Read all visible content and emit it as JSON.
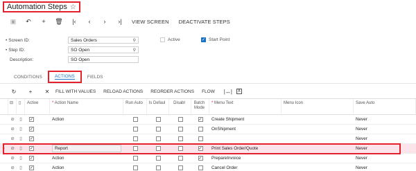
{
  "title": "Automation Steps",
  "toolbar": {
    "view_screen": "VIEW SCREEN",
    "deactivate_steps": "DEACTIVATE STEPS"
  },
  "form": {
    "screen_id_label": "Screen ID:",
    "screen_id_value": "Sales Orders",
    "step_id_label": "Step ID:",
    "step_id_value": "SO Open",
    "description_label": "Description:",
    "description_value": "SO Open",
    "active_label": "Active",
    "start_point_label": "Start Point"
  },
  "tabs": [
    "CONDITIONS",
    "ACTIONS",
    "FIELDS"
  ],
  "grid_toolbar": {
    "fill_with_values": "FILL WITH VALUES",
    "reload_actions": "RELOAD ACTIONS",
    "reorder_actions": "REORDER ACTIONS",
    "flow": "FLOW"
  },
  "columns": {
    "active": "Active",
    "action_name": "Action Name",
    "run_auto": "Run Auto",
    "is_default": "Is Defaul",
    "disable": "Disabl",
    "batch_mode": "Batch Mode",
    "menu_text": "Menu Text",
    "menu_icon": "Menu Icon",
    "save_auto": "Save Auto"
  },
  "rows": [
    {
      "action_name": "Action",
      "menu_text": "Create Shipment",
      "save_auto": "Never",
      "active": true,
      "run_auto": false,
      "is_default": false,
      "disable": false,
      "batch": true
    },
    {
      "action_name": "",
      "menu_text": "OnShipment",
      "save_auto": "Never",
      "active": true,
      "run_auto": false,
      "is_default": false,
      "disable": false,
      "batch": false
    },
    {
      "action_name": "",
      "menu_text": "",
      "save_auto": "Never",
      "active": true,
      "run_auto": false,
      "is_default": false,
      "disable": false,
      "batch": false
    },
    {
      "action_name": "Report",
      "menu_text": "Print Sales Order/Quote",
      "save_auto": "Never",
      "active": true,
      "run_auto": false,
      "is_default": false,
      "disable": false,
      "batch": true
    },
    {
      "action_name": "Action",
      "menu_text": "PrepareInvoice",
      "save_auto": "Never",
      "active": true,
      "run_auto": false,
      "is_default": false,
      "disable": false,
      "batch": true
    },
    {
      "action_name": "Action",
      "menu_text": "Cancel Order",
      "save_auto": "Never",
      "active": true,
      "run_auto": false,
      "is_default": false,
      "disable": false,
      "batch": false
    }
  ]
}
